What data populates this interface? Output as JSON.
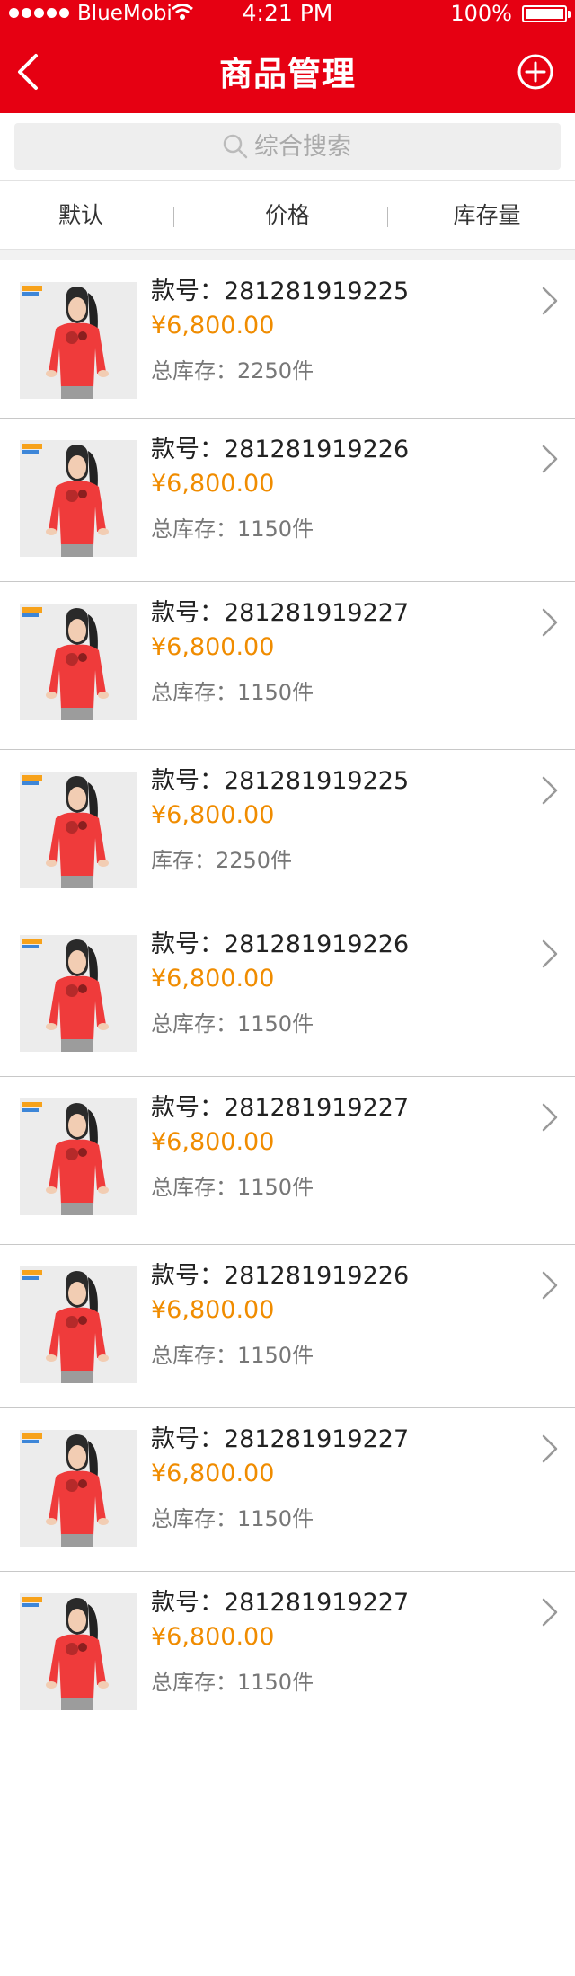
{
  "colors": {
    "accent": "#E60012",
    "price": "#F08C00"
  },
  "status_bar": {
    "carrier": "BlueMobi",
    "time": "4:21 PM",
    "battery_text": "100%",
    "battery_level": 1.0
  },
  "nav": {
    "title": "商品管理",
    "back_icon": "chevron-left-icon",
    "add_icon": "plus-circle-icon"
  },
  "search": {
    "placeholder": "综合搜索"
  },
  "sort_tabs": [
    {
      "label": "默认"
    },
    {
      "label": "价格"
    },
    {
      "label": "库存量"
    }
  ],
  "products": [
    {
      "code": "款号：281281919225",
      "price": "¥6,800.00",
      "stock": "总库存：2250件"
    },
    {
      "code": "款号：281281919226",
      "price": "¥6,800.00",
      "stock": "总库存：1150件"
    },
    {
      "code": "款号：281281919227",
      "price": "¥6,800.00",
      "stock": "总库存：1150件"
    },
    {
      "code": "款号：281281919225",
      "price": "¥6,800.00",
      "stock": "库存：2250件"
    },
    {
      "code": "款号：281281919226",
      "price": "¥6,800.00",
      "stock": "总库存：1150件"
    },
    {
      "code": "款号：281281919227",
      "price": "¥6,800.00",
      "stock": "总库存：1150件"
    },
    {
      "code": "款号：281281919226",
      "price": "¥6,800.00",
      "stock": "总库存：1150件"
    },
    {
      "code": "款号：281281919227",
      "price": "¥6,800.00",
      "stock": "总库存：1150件"
    },
    {
      "code": "款号：281281919227",
      "price": "¥6,800.00",
      "stock": "总库存：1150件"
    }
  ]
}
